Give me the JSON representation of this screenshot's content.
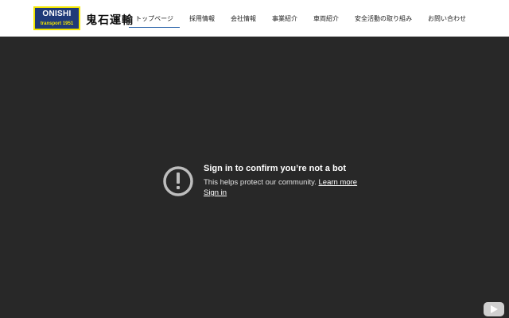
{
  "header": {
    "logo": {
      "top_text": "ONISHI",
      "bottom_text": "transport 1951"
    },
    "brand_jp": "鬼石運輸",
    "nav": [
      {
        "label": "トップページ",
        "active": true
      },
      {
        "label": "採用情報",
        "active": false
      },
      {
        "label": "会社情報",
        "active": false
      },
      {
        "label": "事業紹介",
        "active": false
      },
      {
        "label": "車両紹介",
        "active": false
      },
      {
        "label": "安全活動の取り組み",
        "active": false
      },
      {
        "label": "お問い合わせ",
        "active": false
      }
    ]
  },
  "video": {
    "message": {
      "title": "Sign in to confirm you’re not a bot",
      "subtitle": "This helps protect our community.",
      "learn_more": "Learn more",
      "sign_in": "Sign in",
      "icon": "alert-circle-icon"
    },
    "play_button_icon": "youtube-play-icon"
  },
  "colors": {
    "logo_bg": "#1f3a78",
    "logo_border": "#f2e600",
    "video_bg": "#282828",
    "nav_active_underline": "#3a6fb0"
  }
}
